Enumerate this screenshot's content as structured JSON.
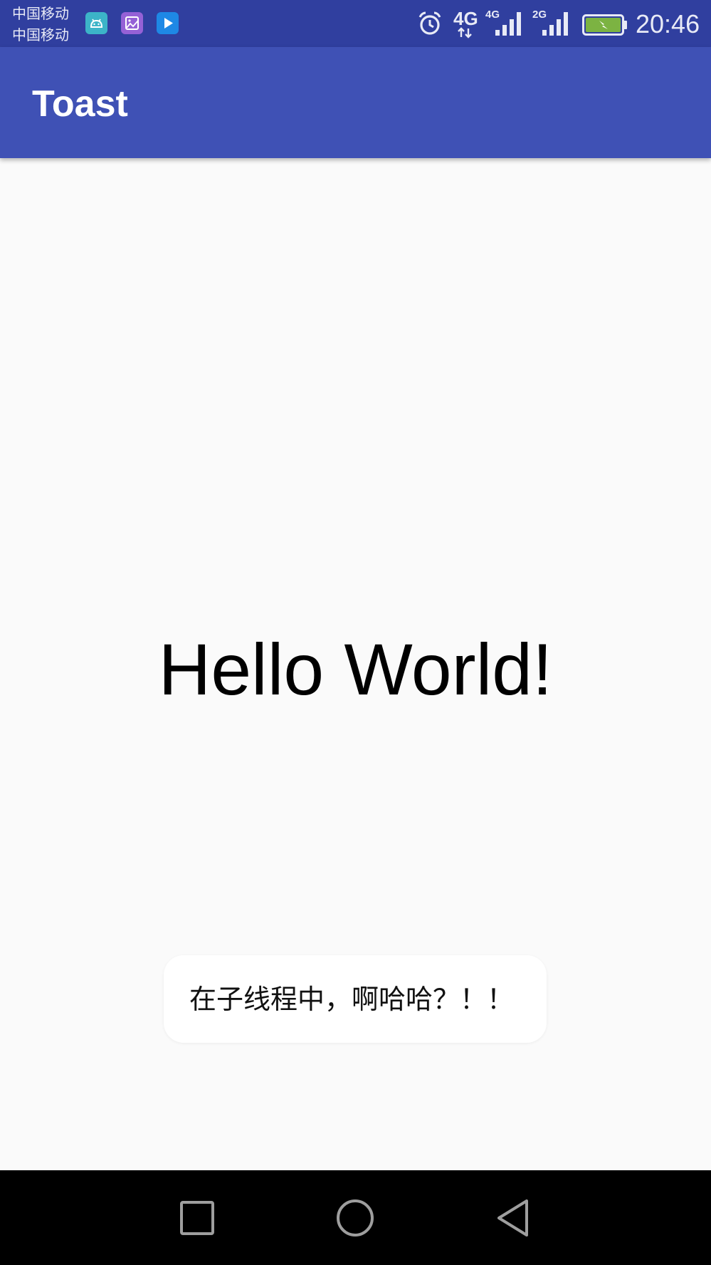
{
  "status_bar": {
    "carrier_1": "中国移动",
    "carrier_2": "中国移动",
    "notification_icons": [
      "android-icon",
      "gallery-icon",
      "play-icon"
    ],
    "network_main": "4G",
    "sim1_network": "4G",
    "sim2_network": "2G",
    "time": "20:46",
    "battery_state": "charging"
  },
  "app_bar": {
    "title": "Toast"
  },
  "main": {
    "text": "Hello World!"
  },
  "toast": {
    "message": "在子线程中，啊哈哈？！！"
  },
  "nav_bar": {
    "buttons": [
      "recents",
      "home",
      "back"
    ]
  },
  "colors": {
    "status_bar": "#303f9f",
    "app_bar": "#3f51b5",
    "background": "#fafafa",
    "battery_fill": "#7cb342"
  }
}
